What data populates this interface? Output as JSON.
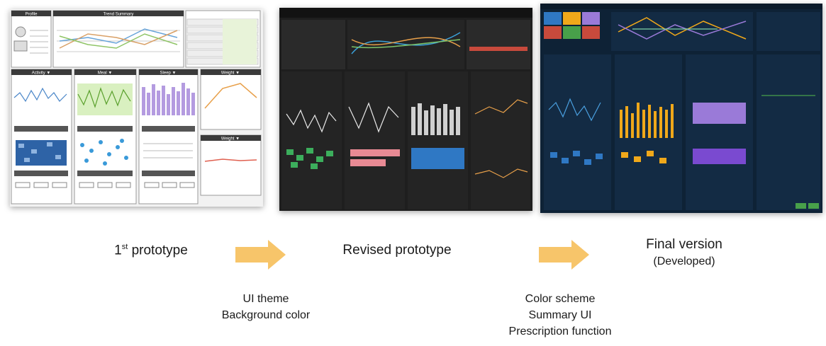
{
  "stages": [
    {
      "label": "1st prototype",
      "label_main": "1",
      "label_sup": "st",
      "label_rest": " prototype"
    },
    {
      "label": "Revised prototype"
    },
    {
      "label": "Final version",
      "sublabel": "(Developed)"
    }
  ],
  "transitions": [
    {
      "changes": [
        "UI theme",
        "Background color"
      ]
    },
    {
      "changes": [
        "Color scheme",
        "Summary UI",
        "Prescription function"
      ]
    }
  ],
  "screenshots": {
    "first": {
      "panels": [
        "Profile",
        "Trend Summary",
        "Activity ▼",
        "Meal ▼",
        "Sleep ▼",
        "Weight ▼",
        "Weight ▼"
      ]
    }
  },
  "colors": {
    "arrow": "#f7c56a",
    "first_bg": "#f2f2f2",
    "revised_bg": "#1e1e1e",
    "final_bg": "#0e2236",
    "final_accent_orange": "#f0a81a",
    "final_accent_purple": "#9a7ad8",
    "final_accent_blue": "#2f78c4"
  }
}
